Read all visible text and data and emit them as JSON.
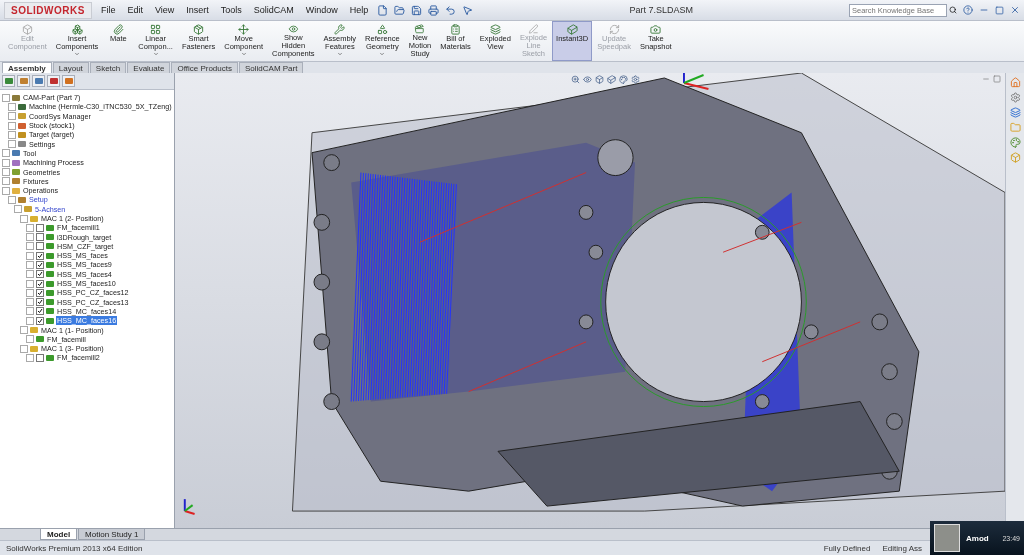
{
  "app": {
    "logo": "SOLIDWORKS",
    "title": "Part 7.SLDASM"
  },
  "menu": [
    "File",
    "Edit",
    "View",
    "Insert",
    "Tools",
    "SolidCAM",
    "Window",
    "Help"
  ],
  "search": {
    "placeholder": "Search Knowledge Base"
  },
  "ribbon": [
    {
      "label": "Edit\nComponent",
      "disabled": true,
      "dropdown": false,
      "selected": false
    },
    {
      "label": "Insert\nComponents",
      "disabled": false,
      "dropdown": true,
      "selected": false
    },
    {
      "label": "Mate",
      "disabled": false,
      "dropdown": false,
      "selected": false
    },
    {
      "label": "Linear\nCompon...",
      "disabled": false,
      "dropdown": true,
      "selected": false
    },
    {
      "label": "Smart\nFasteners",
      "disabled": false,
      "dropdown": false,
      "selected": false
    },
    {
      "label": "Move\nComponent",
      "disabled": false,
      "dropdown": true,
      "selected": false
    },
    {
      "label": "Show\nHidden\nComponents",
      "disabled": false,
      "dropdown": false,
      "selected": false
    },
    {
      "label": "Assembly\nFeatures",
      "disabled": false,
      "dropdown": true,
      "selected": false
    },
    {
      "label": "Reference\nGeometry",
      "disabled": false,
      "dropdown": true,
      "selected": false
    },
    {
      "label": "New\nMotion\nStudy",
      "disabled": false,
      "dropdown": false,
      "selected": false
    },
    {
      "label": "Bill of\nMaterials",
      "disabled": false,
      "dropdown": false,
      "selected": false
    },
    {
      "label": "Exploded\nView",
      "disabled": false,
      "dropdown": false,
      "selected": false
    },
    {
      "label": "Explode\nLine\nSketch",
      "disabled": true,
      "dropdown": false,
      "selected": false
    },
    {
      "label": "Instant3D",
      "disabled": false,
      "dropdown": false,
      "selected": true
    },
    {
      "label": "Update\nSpeedpak",
      "disabled": true,
      "dropdown": false,
      "selected": false
    },
    {
      "label": "Take\nSnapshot",
      "disabled": false,
      "dropdown": false,
      "selected": false
    }
  ],
  "tabs": [
    {
      "label": "Assembly",
      "selected": true
    },
    {
      "label": "Layout",
      "selected": false
    },
    {
      "label": "Sketch",
      "selected": false
    },
    {
      "label": "Evaluate",
      "selected": false
    },
    {
      "label": "Office Products",
      "selected": false
    },
    {
      "label": "SolidCAM Part",
      "selected": false
    }
  ],
  "tree": [
    {
      "label": "CAM-Part (Part 7)",
      "kind": "part",
      "selected": false,
      "current": false,
      "children": [
        {
          "label": "Machine (Hermle-C30_iTNC530_5X_TZeng)",
          "kind": "machine",
          "selected": false,
          "current": false
        },
        {
          "label": "CoordSys Manager",
          "kind": "coordsys",
          "selected": false,
          "current": false
        },
        {
          "label": "Stock (stock1)",
          "kind": "stock",
          "selected": false,
          "current": false
        },
        {
          "label": "Target (target)",
          "kind": "target",
          "selected": false,
          "current": false
        },
        {
          "label": "Settings",
          "kind": "settings",
          "selected": false,
          "current": false
        }
      ]
    },
    {
      "label": "Tool",
      "kind": "tool",
      "selected": false,
      "current": false
    },
    {
      "label": "Machining Process",
      "kind": "process",
      "selected": false,
      "current": false
    },
    {
      "label": "Geometries",
      "kind": "geometry",
      "selected": false,
      "current": false
    },
    {
      "label": "Fixtures",
      "kind": "fixture",
      "selected": false,
      "current": false
    },
    {
      "label": "Operations",
      "kind": "folder",
      "selected": false,
      "current": false,
      "children": [
        {
          "label": "Setup",
          "kind": "fixture",
          "selected": false,
          "current": true,
          "children": [
            {
              "label": "5-Achsen",
              "kind": "coordsys",
              "selected": false,
              "current": true,
              "children": [
                {
                  "label": "MAC 1 (2- Position)",
                  "kind": "position",
                  "selected": false,
                  "current": false,
                  "children": [
                    {
                      "label": "FM_facemill1",
                      "kind": "operation",
                      "checked": false,
                      "selected": false,
                      "current": false
                    },
                    {
                      "label": "i3DRough_target",
                      "kind": "operation",
                      "checked": false,
                      "selected": false,
                      "current": false
                    },
                    {
                      "label": "HSM_CZF_target",
                      "kind": "operation",
                      "checked": false,
                      "selected": false,
                      "current": false
                    },
                    {
                      "label": "HSS_MS_faces",
                      "kind": "operation",
                      "checked": true,
                      "selected": false,
                      "current": false
                    },
                    {
                      "label": "HSS_MS_faces9",
                      "kind": "operation",
                      "checked": true,
                      "selected": false,
                      "current": false
                    },
                    {
                      "label": "HSS_MS_faces4",
                      "kind": "operation",
                      "checked": true,
                      "selected": false,
                      "current": false
                    },
                    {
                      "label": "HSS_MS_faces10",
                      "kind": "operation",
                      "checked": true,
                      "selected": false,
                      "current": false
                    },
                    {
                      "label": "HSS_PC_CZ_faces12",
                      "kind": "operation",
                      "checked": true,
                      "selected": false,
                      "current": false
                    },
                    {
                      "label": "HSS_PC_CZ_faces13",
                      "kind": "operation",
                      "checked": true,
                      "selected": false,
                      "current": false
                    },
                    {
                      "label": "HSS_MC_faces14",
                      "kind": "operation",
                      "checked": true,
                      "selected": false,
                      "current": false
                    },
                    {
                      "label": "HSS_MC_faces16",
                      "kind": "operation",
                      "checked": true,
                      "selected": true,
                      "current": false
                    }
                  ]
                },
                {
                  "label": "MAC 1 (1- Position)",
                  "kind": "position",
                  "selected": false,
                  "current": false,
                  "children": [
                    {
                      "label": "FM_facemill",
                      "kind": "operation",
                      "selected": false,
                      "current": false
                    }
                  ]
                },
                {
                  "label": "MAC 1 (3- Position)",
                  "kind": "position",
                  "selected": false,
                  "current": false,
                  "children": [
                    {
                      "label": "FM_facemill2",
                      "kind": "operation",
                      "checked": false,
                      "selected": false,
                      "current": false
                    }
                  ]
                }
              ]
            }
          ]
        }
      ]
    }
  ],
  "bottom_tabs": [
    {
      "label": "Model",
      "selected": true
    },
    {
      "label": "Motion Study 1",
      "selected": false
    }
  ],
  "status_bar": {
    "edition": "SolidWorks Premium 2013 x64 Edition",
    "state": "Fully Defined",
    "mode": "Editing Ass"
  },
  "notification": {
    "name": "Amod",
    "time": "23:49"
  }
}
